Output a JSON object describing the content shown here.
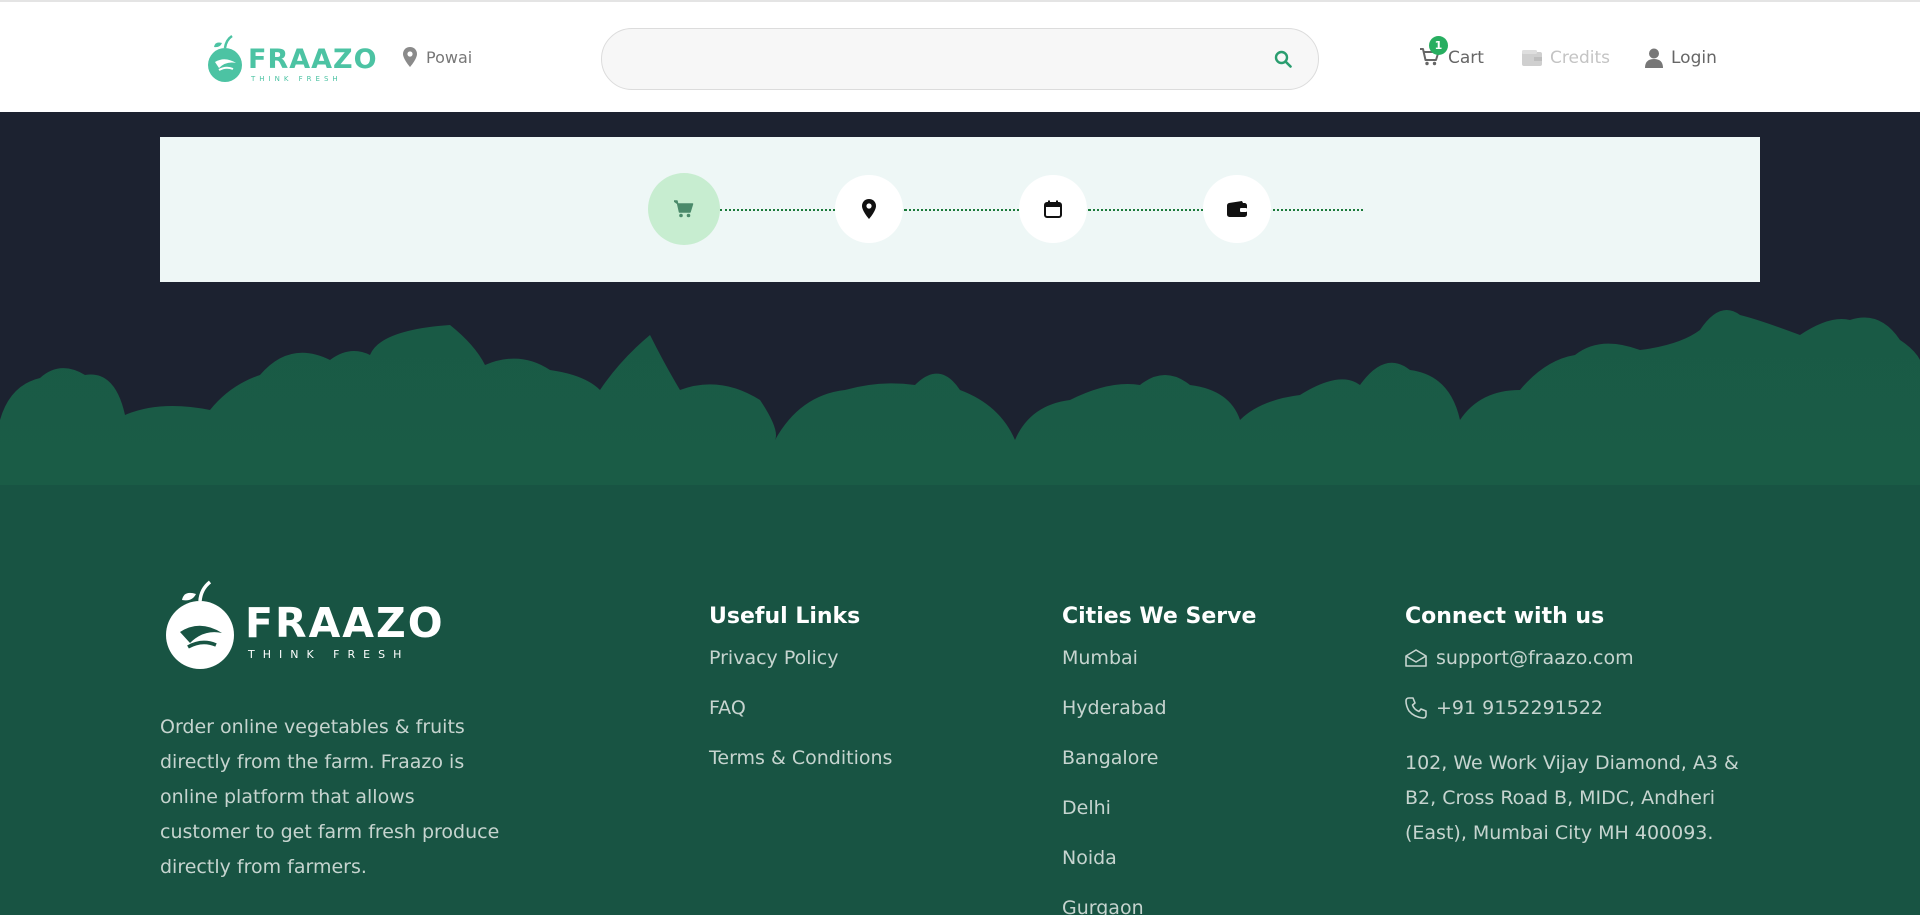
{
  "header": {
    "brand": "FRAAZO",
    "tagline": "THINK FRESH",
    "location": "Powai",
    "search": {
      "value": "",
      "placeholder": ""
    },
    "cart": {
      "label": "Cart",
      "count": "1"
    },
    "credits_label": "Credits",
    "login_label": "Login",
    "accent_color": "#4cc3a3"
  },
  "checkout_steps": {
    "steps": [
      {
        "icon": "cart-icon",
        "active": true
      },
      {
        "icon": "map-marker-icon",
        "active": false
      },
      {
        "icon": "calendar-icon",
        "active": false
      },
      {
        "icon": "wallet-icon",
        "active": false
      }
    ],
    "active_color": "#c7edd0",
    "connector_color": "#1b7a3a"
  },
  "footer": {
    "brand": "FRAAZO",
    "tagline": "THINK FRESH",
    "about": "Order online vegetables & fruits directly from the farm. Fraazo is online platform that allows customer to get farm fresh produce directly from farmers.",
    "useful_links": {
      "title": "Useful Links",
      "items": [
        "Privacy Policy",
        "FAQ",
        "Terms & Conditions"
      ]
    },
    "cities": {
      "title": "Cities We Serve",
      "items": [
        "Mumbai",
        "Hyderabad",
        "Bangalore",
        "Delhi",
        "Noida",
        "Gurgaon"
      ]
    },
    "connect": {
      "title": "Connect with us",
      "email": "support@fraazo.com",
      "phone": "+91 9152291522",
      "address": "102, We Work Vijay Diamond, A3 & B2, Cross Road B, MIDC, Andheri (East), Mumbai City MH 400093."
    },
    "background_color": "#185443"
  }
}
